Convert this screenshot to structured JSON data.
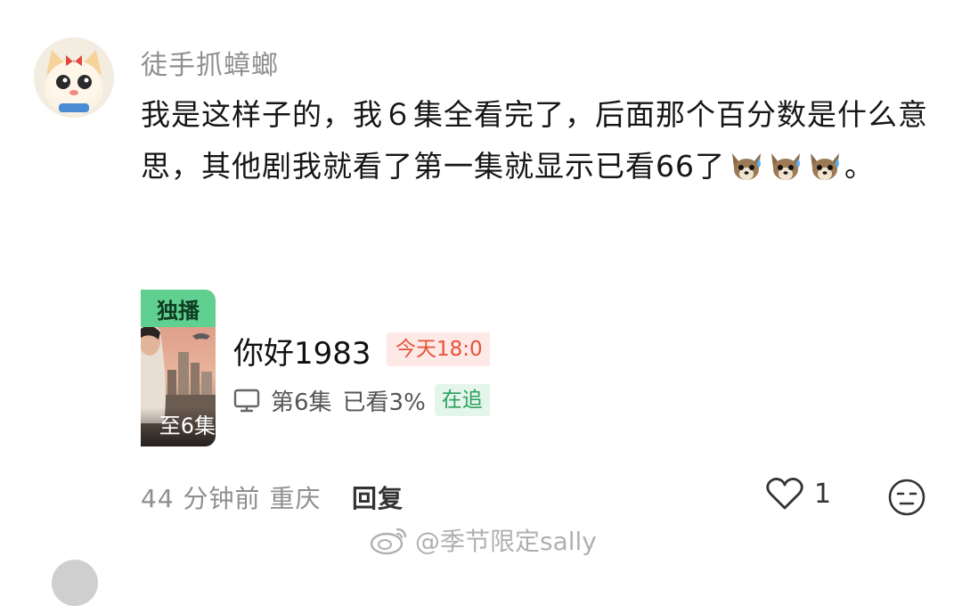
{
  "comment": {
    "username": "徒手抓蟑螂",
    "text": "我是这样子的，我６集全看完了，后面那个百分数是什么意思，其他剧我就看了第一集就显示已看66了",
    "text_end": "。",
    "emoji_icon": "sweating-dog-emoji"
  },
  "show_card": {
    "badge": "独播",
    "thumb_caption": "至6集",
    "title": "你好1983",
    "update_tag": "今天18:0",
    "episode": "第6集",
    "watched": "已看3%",
    "status_tag": "在追"
  },
  "meta": {
    "time": "44 分钟前",
    "location": "重庆",
    "reply_label": "回复",
    "like_count": "1"
  },
  "watermark": {
    "text": "@季节限定sally",
    "icon": "weibo-icon"
  },
  "colors": {
    "badge_green": "#5fd08f",
    "update_red": "#e6533c",
    "status_green": "#2aa060"
  }
}
